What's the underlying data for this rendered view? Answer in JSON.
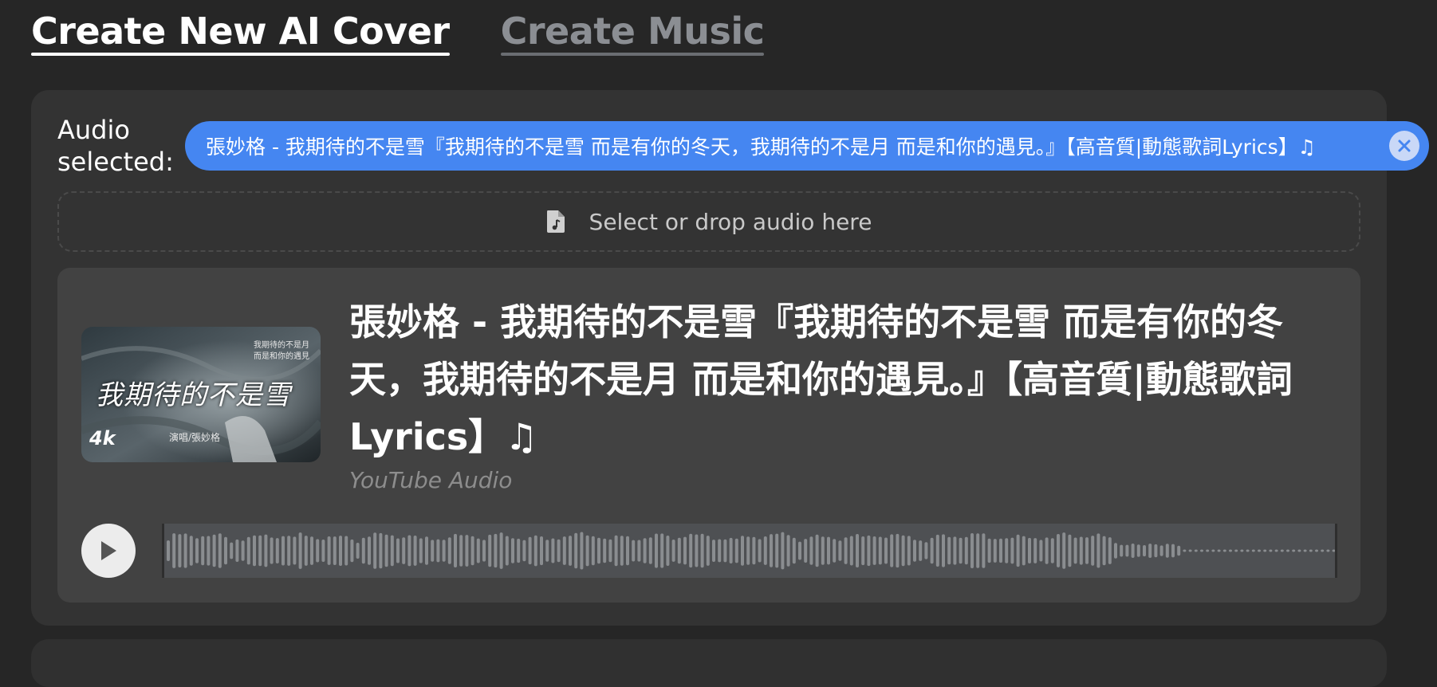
{
  "tabs": [
    {
      "label": "Create New AI Cover",
      "active": true
    },
    {
      "label": "Create Music",
      "active": false
    }
  ],
  "audio_selected": {
    "label_line1": "Audio",
    "label_line2": "selected:",
    "chip_text": "張妙格 - 我期待的不是雪『我期待的不是雪 而是有你的冬天，我期待的不是月 而是和你的遇見。』【高音質|動態歌詞Lyrics】♫"
  },
  "dropzone": {
    "text": "Select or drop audio here",
    "icon": "audio-file-icon"
  },
  "track": {
    "title": "張妙格 - 我期待的不是雪『我期待的不是雪 而是有你的冬天，我期待的不是月 而是和你的遇見。』【高音質|動態歌詞Lyrics】♫",
    "source": "YouTube Audio",
    "thumbnail": {
      "big_text": "我期待的不是雪",
      "small_line1": "我期待的不是月",
      "small_line2": "而是和你的遇見",
      "singer_credit": "演唱/張妙格",
      "logo": "4k"
    }
  },
  "player": {
    "play_icon": "play-icon",
    "played_fraction": 0
  },
  "colors": {
    "background": "#262626",
    "panel": "#333333",
    "card": "#424242",
    "chip": "#4586f1",
    "waveform_bg": "#4e5053",
    "waveform_bar": "#8a8d90"
  }
}
